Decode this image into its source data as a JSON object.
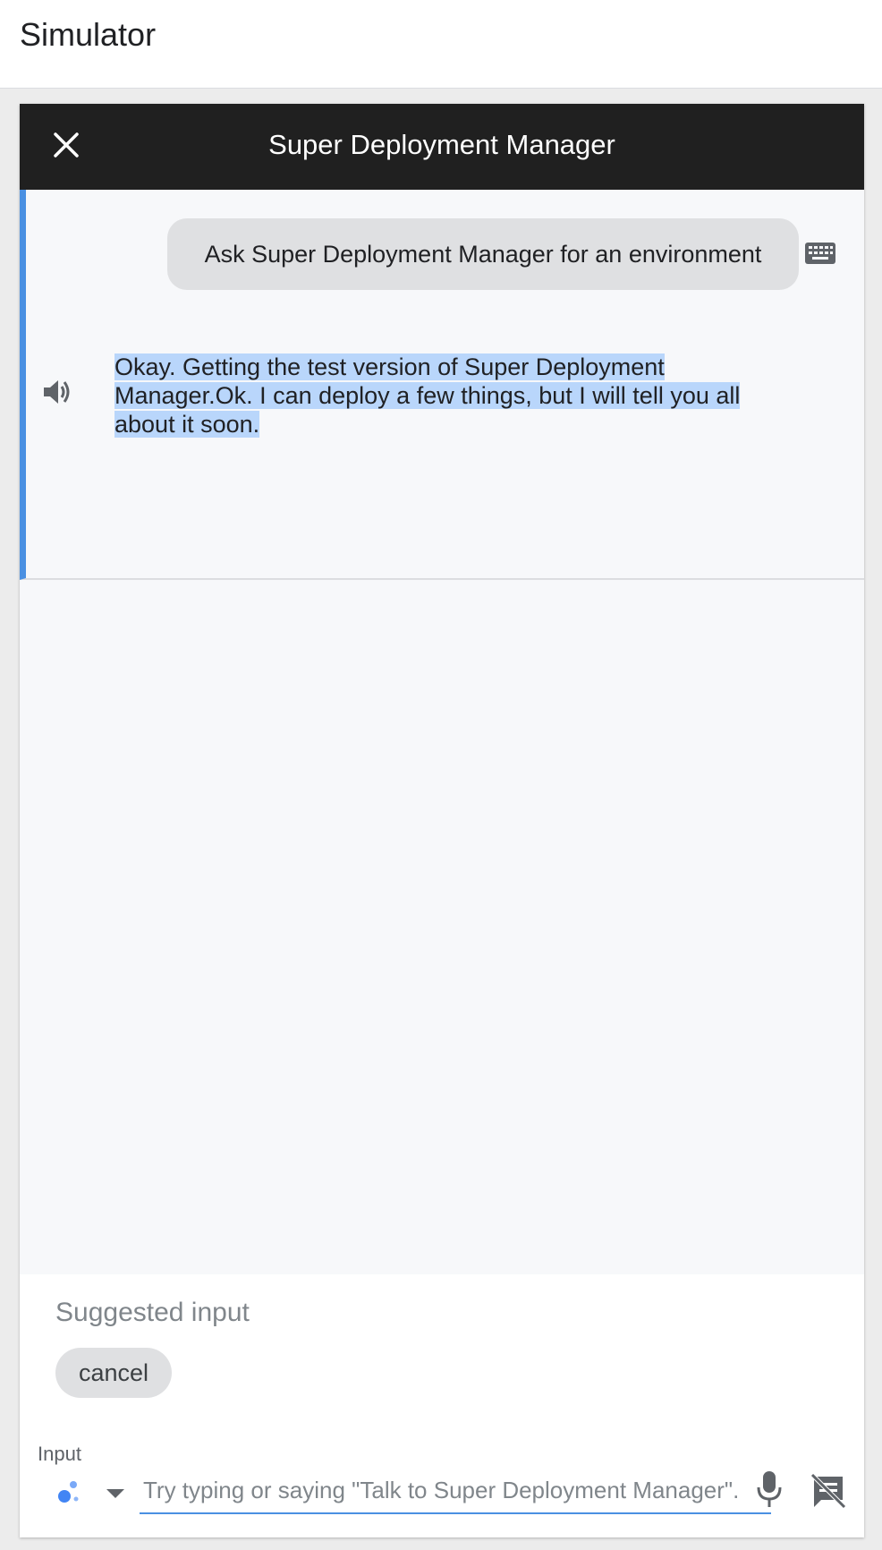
{
  "page": {
    "title": "Simulator"
  },
  "simulator": {
    "title": "Super Deployment Manager",
    "close_icon": "close-icon",
    "conversation": {
      "user_message": "Ask Super Deployment Manager for an environment",
      "user_message_icon": "keyboard-icon",
      "bot_message": "Okay. Getting the test version of Super Deployment Manager.Ok. I can deploy a few things, but I will tell you all about it soon.",
      "bot_message_icon": "speaker-icon"
    },
    "suggestions": {
      "label": "Suggested input",
      "chips": [
        "cancel"
      ]
    },
    "input": {
      "label": "Input",
      "placeholder": "Try typing or saying \"Talk to Super Deployment Manager\".",
      "value": "",
      "mode_icon": "google-assistant-icon",
      "mic_icon": "microphone-icon",
      "display_icon": "no-display-icon"
    }
  },
  "colors": {
    "header_bg": "#202020",
    "accent": "#4a90e2",
    "selection": "#b9d6fb",
    "bubble_bg": "#dfe0e2"
  }
}
